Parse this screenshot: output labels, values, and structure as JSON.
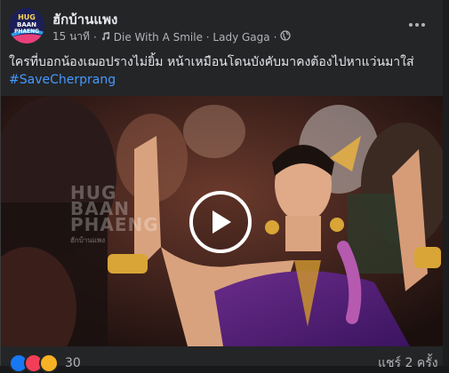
{
  "post": {
    "author": "ฮักบ้านแพง",
    "time": "15 นาที",
    "music_separator": "·",
    "song": "Die With A Smile · Lady Gaga",
    "dot": "·",
    "caption": "ใครที่บอกน้องเฌอปรางไม่ยิ้ม หน้าเหมือนโดนบังคับมาคงต้องไปหาแว่นมาใส่",
    "hashtag": "#SaveCherprang",
    "reaction_count": "30",
    "shares": "แชร์ 2 ครั้ง"
  },
  "avatar": {
    "line1": "HUG",
    "line2": "BAAN",
    "line3": "PHAENG"
  },
  "watermark": {
    "line1": "HUG",
    "line2": "BAAN",
    "line3": "PHAENG",
    "tag": "ฮักบ้านแพง"
  },
  "colors": {
    "background": "#242526",
    "link": "#4599ff",
    "secondary_text": "#b0b3b8",
    "like": "#1877f2",
    "love": "#f33e58",
    "haha": "#f7b125"
  },
  "icons": {
    "music": "music-note-icon",
    "privacy": "globe-icon",
    "more": "more-options-icon",
    "play": "play-icon"
  }
}
